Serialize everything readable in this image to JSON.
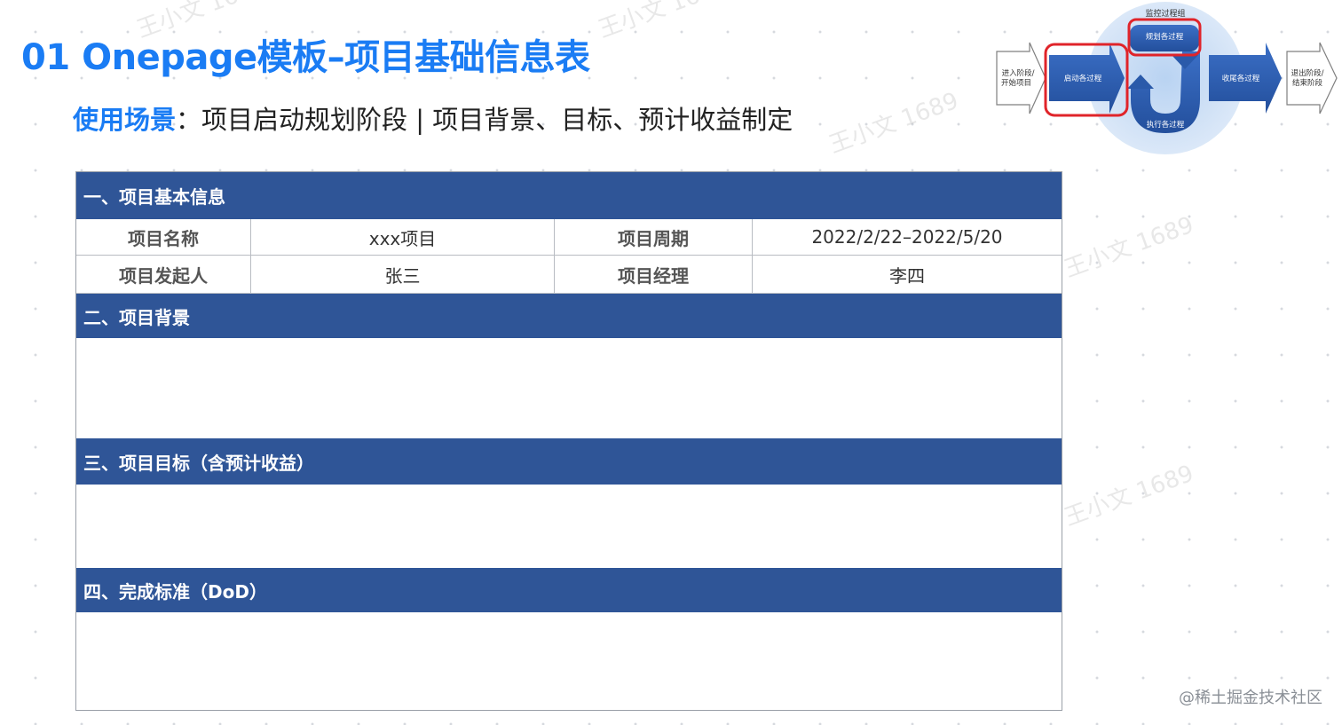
{
  "title": "01 Onepage模板–项目基础信息表",
  "subtitle": {
    "label": "使用场景",
    "separator": "：",
    "text": "项目启动规划阶段 | 项目背景、目标、预计收益制定"
  },
  "table": {
    "sections": {
      "basic": "一、项目基本信息",
      "background": "二、项目背景",
      "goals": "三、项目目标（含预计收益）",
      "dod": "四、完成标准（DoD）"
    },
    "rows": [
      {
        "k1": "项目名称",
        "v1": "xxx项目",
        "k2": "项目周期",
        "v2": "2022/2/22–2022/5/20"
      },
      {
        "k1": "项目发起人",
        "v1": "张三",
        "k2": "项目经理",
        "v2": "李四"
      }
    ]
  },
  "diagram": {
    "monitor_group": "监控过程组",
    "planning": "规划各过程",
    "initiating": "启动各过程",
    "executing": "执行各过程",
    "closing": "收尾各过程",
    "enter_line1": "进入阶段/",
    "enter_line2": "开始项目",
    "exit_line1": "退出阶段/",
    "exit_line2": "结束阶段"
  },
  "watermark": "王小文 1689",
  "footer": "@稀土掘金技术社区",
  "colors": {
    "accent": "#1a7cf4",
    "section_header": "#2f5597",
    "highlight": "#e0242a"
  }
}
